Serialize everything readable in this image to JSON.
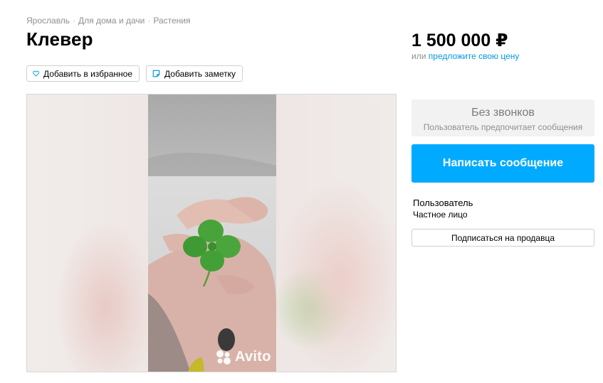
{
  "breadcrumb": {
    "items": [
      "Ярославль",
      "Для дома и дачи",
      "Растения"
    ],
    "separator": "·"
  },
  "listing": {
    "title": "Клевер",
    "price": "1 500 000 ₽",
    "price_prefix": "или",
    "offer_link": "предложите свою цену"
  },
  "actions": {
    "favorite_label": "Добавить в избранное",
    "note_label": "Добавить заметку"
  },
  "gallery": {
    "watermark": "Avito",
    "image_description_icon": "four-leaf-clover-photo"
  },
  "contact": {
    "no_calls_title": "Без звонков",
    "no_calls_subtitle": "Пользователь предпочитает сообщения",
    "write_message_label": "Написать сообщение"
  },
  "seller": {
    "name": "Пользователь",
    "type": "Частное лицо",
    "subscribe_label": "Подписаться на продавца"
  },
  "colors": {
    "accent": "#00aaff",
    "link": "#0099e6",
    "muted_text": "#8f8f8f",
    "panel_bg": "#f2f2f2"
  }
}
